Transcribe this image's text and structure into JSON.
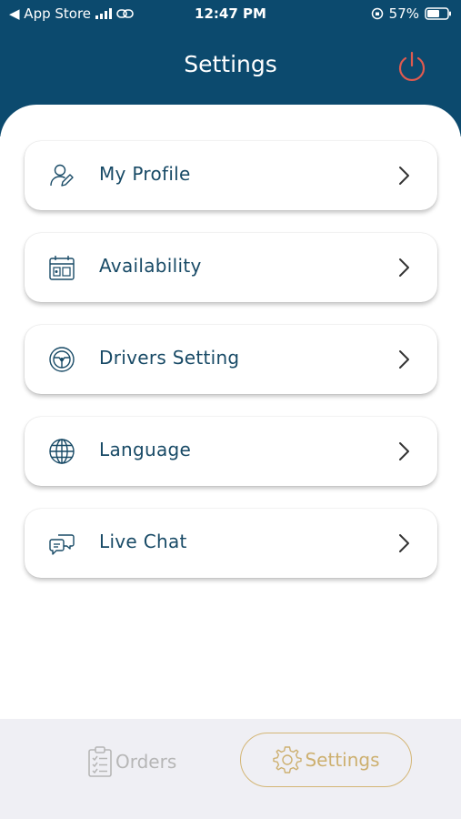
{
  "status_bar": {
    "back_label": "◀ App Store",
    "time": "12:47 PM",
    "battery": "57%"
  },
  "header": {
    "title": "Settings",
    "power_icon": "power-icon"
  },
  "menu": {
    "items": [
      {
        "label": "My Profile",
        "icon": "user-edit-icon"
      },
      {
        "label": "Availability",
        "icon": "calendar-icon"
      },
      {
        "label": "Drivers Setting",
        "icon": "steering-wheel-icon"
      },
      {
        "label": "Language",
        "icon": "globe-icon"
      },
      {
        "label": "Live Chat",
        "icon": "chat-icon"
      }
    ]
  },
  "tabbar": {
    "orders_label": "Orders",
    "settings_label": "Settings",
    "active_tab": "Settings"
  },
  "colors": {
    "header_bg": "#0c4a6e",
    "power_red": "#e05a4f",
    "label_blue": "#184a66",
    "active_gold": "#cdb070",
    "inactive_gray": "#b6b6b6"
  }
}
